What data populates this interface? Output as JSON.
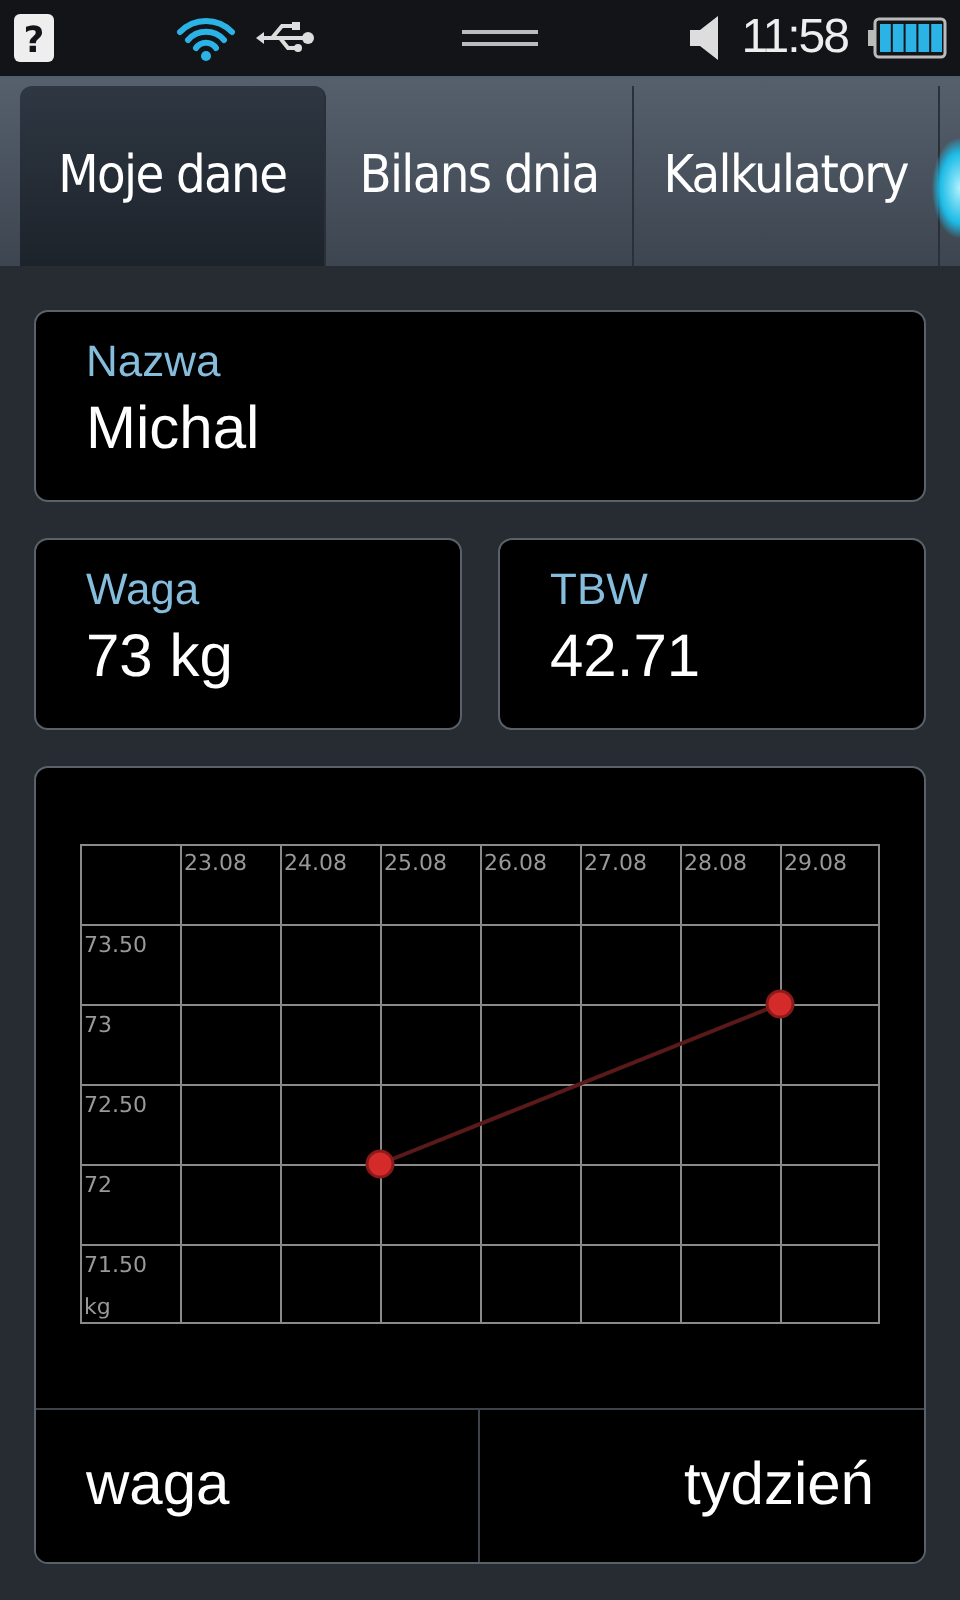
{
  "status_bar": {
    "help_glyph": "?",
    "time": "11:58"
  },
  "tabs": [
    {
      "label": "Moje dane",
      "selected": true
    },
    {
      "label": "Bilans dnia",
      "selected": false
    },
    {
      "label": "Kalkulatory",
      "selected": false
    }
  ],
  "name_field": {
    "label": "Nazwa",
    "value": "Michal"
  },
  "stats": [
    {
      "label": "Waga",
      "value": "73 kg"
    },
    {
      "label": "TBW",
      "value": "42.71"
    }
  ],
  "chart_card": {
    "chart_data": {
      "type": "line",
      "ylabel": "kg",
      "categories": [
        "23.08",
        "24.08",
        "25.08",
        "26.08",
        "27.08",
        "28.08",
        "29.08"
      ],
      "series": [
        {
          "color": "#d42a2a",
          "marker": "circle",
          "values": [
            null,
            null,
            72,
            null,
            null,
            null,
            73
          ]
        }
      ],
      "ylim": [
        71,
        74
      ],
      "grid": true,
      "yticks": [
        {
          "value": 73.5,
          "label": "73.50"
        },
        {
          "value": 73,
          "label": "73"
        },
        {
          "value": 72.5,
          "label": "72.50"
        },
        {
          "value": 72,
          "label": "72"
        },
        {
          "value": 71.5,
          "label": "71.50"
        }
      ]
    },
    "selectors": [
      "waga",
      "tydzień"
    ]
  }
}
